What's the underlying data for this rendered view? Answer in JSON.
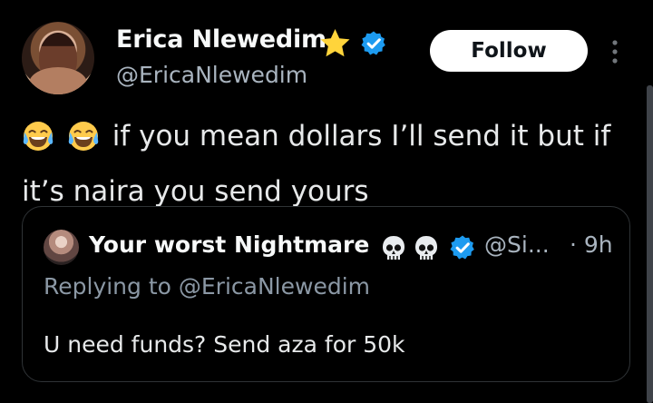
{
  "author": {
    "display_name": "Erica Nlewedim",
    "handle": "@EricaNlewedim",
    "avatar": "profile-photo",
    "badges": [
      "star-icon",
      "verified-icon"
    ]
  },
  "actions": {
    "follow_label": "Follow",
    "more_icon": "more-vertical-icon"
  },
  "tweet": {
    "emojis": [
      "face-with-tears-of-joy-icon",
      "face-with-tears-of-joy-icon"
    ],
    "line1": "if you mean dollars I’ll send it but if",
    "line2": "it’s naira you send yours"
  },
  "quoted_tweet": {
    "display_name": "Your worst Nightmare",
    "badges": [
      "skull-icon",
      "skull-icon",
      "verified-icon"
    ],
    "handle": "@Si...",
    "time": "· 9h",
    "replying_to": "Replying to @EricaNlewedim",
    "text": "U need funds? Send aza for 50k"
  },
  "colors": {
    "background": "#000000",
    "primary_text": "#e7e9ea",
    "secondary_text": "#a9b4bf",
    "verified_blue": "#1d9bf0",
    "star": "#ffd43b"
  }
}
